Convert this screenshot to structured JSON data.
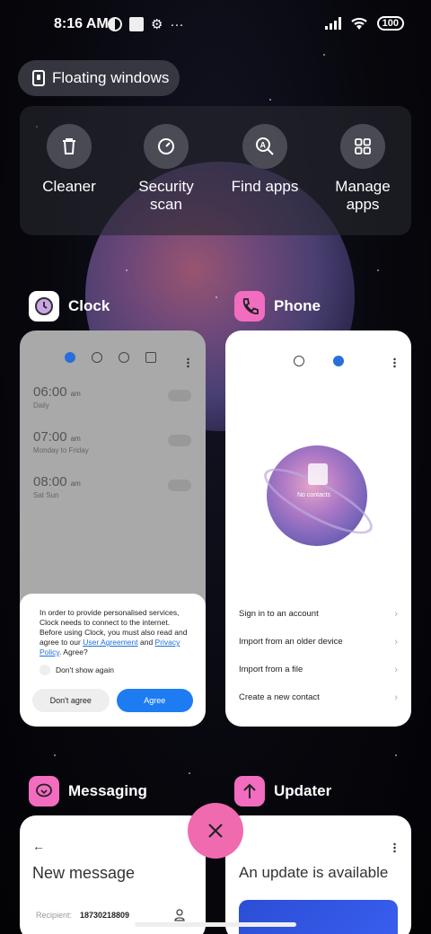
{
  "status_bar": {
    "time": "8:16 AM",
    "more": "···",
    "battery": "100"
  },
  "floating_windows": {
    "label": "Floating windows"
  },
  "tools": [
    {
      "label": "Cleaner",
      "icon": "trash-icon"
    },
    {
      "label": "Security scan",
      "icon": "shield-scan-icon"
    },
    {
      "label": "Find apps",
      "icon": "search-apps-icon"
    },
    {
      "label": "Manage apps",
      "icon": "grid-icon"
    }
  ],
  "apps": {
    "clock": {
      "name": "Clock",
      "icon_color": "#ffffff",
      "alarms": [
        {
          "time": "06:00",
          "ampm": "am",
          "repeat": "Daily"
        },
        {
          "time": "07:00",
          "ampm": "am",
          "repeat": "Monday to Friday"
        },
        {
          "time": "08:00",
          "ampm": "am",
          "repeat": "Sat Sun"
        }
      ],
      "consent": {
        "text_1": "In order to provide personalised services, Clock needs to connect to the internet. Before using Clock, you must also read and agree to our ",
        "link_1": "User Agreement",
        "text_2": " and ",
        "link_2": "Privacy Policy",
        "text_3": ". Agree?",
        "checkbox": "Don't show again",
        "disagree": "Don't agree",
        "agree": "Agree"
      }
    },
    "phone": {
      "name": "Phone",
      "icon_color": "#f26cc0",
      "empty_text": "No contacts",
      "menu": [
        "Sign in to an account",
        "Import from an older device",
        "Import from a file",
        "Create a new contact"
      ]
    },
    "messaging": {
      "name": "Messaging",
      "icon_color": "#f26cc0",
      "title": "New message",
      "recipient_label": "Recipient:",
      "recipient_value": "18730218809"
    },
    "updater": {
      "name": "Updater",
      "icon_color": "#f26cc0",
      "title": "An update is available"
    }
  },
  "accent_colors": {
    "pink": "#f06ab0",
    "blue": "#1e7cf2"
  }
}
